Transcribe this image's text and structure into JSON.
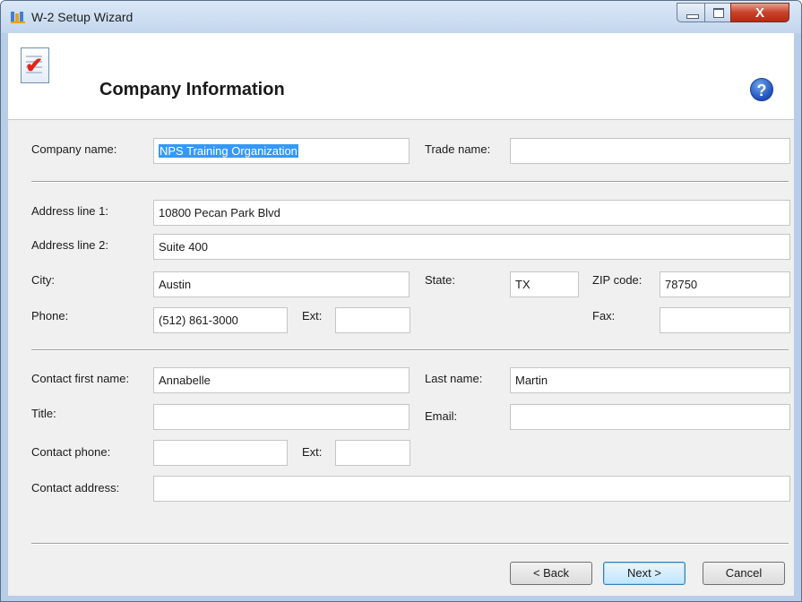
{
  "window": {
    "title": "W-2 Setup Wizard",
    "close_glyph": "X"
  },
  "header": {
    "title": "Company Information",
    "help_glyph": "?"
  },
  "company": {
    "name_label": "Company name:",
    "name_value": "NPS Training Organization",
    "trade_label": "Trade name:",
    "trade_value": ""
  },
  "address": {
    "line1_label": "Address line 1:",
    "line1_value": "10800 Pecan Park Blvd",
    "line2_label": "Address line 2:",
    "line2_value": "Suite 400",
    "city_label": "City:",
    "city_value": "Austin",
    "state_label": "State:",
    "state_value": "TX",
    "zip_label": "ZIP code:",
    "zip_value": "78750",
    "phone_label": "Phone:",
    "phone_value": "(512) 861-3000",
    "ext_label": "Ext:",
    "ext_value": "",
    "fax_label": "Fax:",
    "fax_value": ""
  },
  "contact": {
    "first_label": "Contact first name:",
    "first_value": "Annabelle",
    "last_label": "Last name:",
    "last_value": "Martin",
    "title_label": "Title:",
    "title_value": "",
    "email_label": "Email:",
    "email_value": "",
    "phone_label": "Contact phone:",
    "phone_value": "",
    "ext_label": "Ext:",
    "ext_value": "",
    "address_label": "Contact address:",
    "address_value": ""
  },
  "buttons": {
    "back": "< Back",
    "next": "Next >",
    "cancel": "Cancel"
  },
  "icons": {
    "app": "w2-app-icon",
    "document": "document-check-icon",
    "help": "help-icon"
  }
}
